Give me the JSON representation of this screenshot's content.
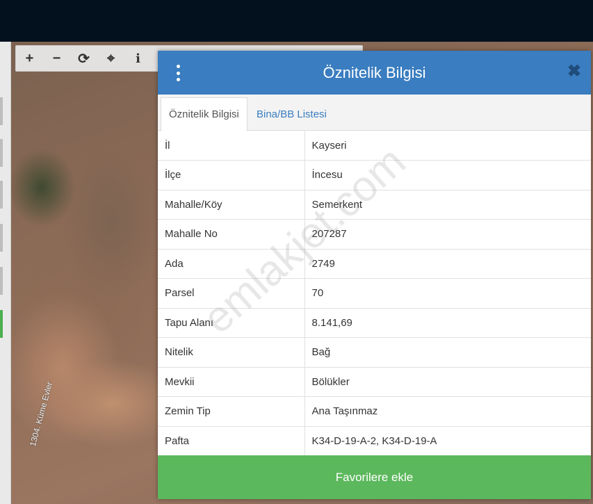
{
  "map": {
    "road_label": "1304. Küme Evler"
  },
  "toolbar": {
    "tools": [
      {
        "icon": "plus-icon",
        "glyph": "+"
      },
      {
        "icon": "minus-icon",
        "glyph": "−"
      },
      {
        "icon": "refresh-icon",
        "glyph": "⟳"
      },
      {
        "icon": "locate-icon",
        "glyph": "⌖"
      },
      {
        "icon": "info-icon",
        "glyph": "i"
      }
    ]
  },
  "panel": {
    "title": "Öznitelik Bilgisi",
    "close_glyph": "✖",
    "tabs": [
      {
        "label": "Öznitelik Bilgisi",
        "active": true
      },
      {
        "label": "Bina/BB Listesi",
        "active": false
      }
    ],
    "rows": [
      {
        "key": "İl",
        "value": "Kayseri"
      },
      {
        "key": "İlçe",
        "value": "İncesu"
      },
      {
        "key": "Mahalle/Köy",
        "value": "Semerkent"
      },
      {
        "key": "Mahalle No",
        "value": "207287"
      },
      {
        "key": "Ada",
        "value": "2749"
      },
      {
        "key": "Parsel",
        "value": "70"
      },
      {
        "key": "Tapu Alanı",
        "value": "8.141,69"
      },
      {
        "key": "Nitelik",
        "value": "Bağ"
      },
      {
        "key": "Mevkii",
        "value": "Bölükler"
      },
      {
        "key": "Zemin Tip",
        "value": "Ana Taşınmaz"
      },
      {
        "key": "Pafta",
        "value": "K34-D-19-A-2, K34-D-19-A"
      }
    ],
    "favorite_button": "Favorilere ekle"
  },
  "watermark": "emlakjet.com",
  "colors": {
    "header_blue": "#3a7dc0",
    "button_green": "#5cb85c",
    "topbar": "#03111f"
  }
}
